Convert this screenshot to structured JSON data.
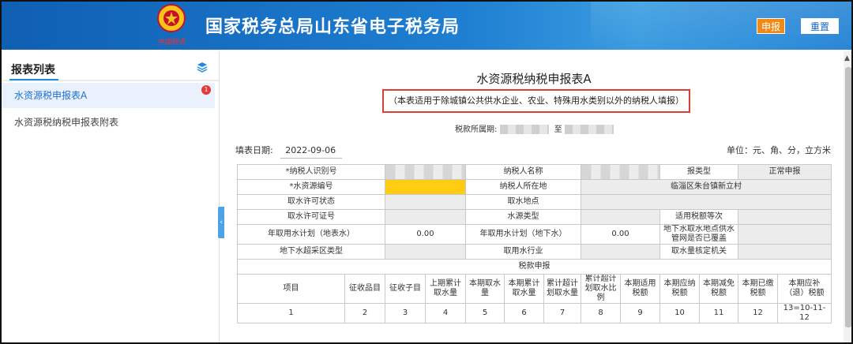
{
  "header": {
    "title": "国家税务总局山东省电子税务局",
    "emblem_caption": "中国税务",
    "submit_label": "申报",
    "reset_label": "重置"
  },
  "sidebar": {
    "title": "报表列表",
    "items": [
      {
        "label": "水资源税申报表A",
        "badge": "1",
        "active": true
      },
      {
        "label": "水资源税纳税申报表附表",
        "active": false
      }
    ]
  },
  "form": {
    "title": "水资源税纳税申报表A",
    "note": "（本表适用于除城镇公共供水企业、农业、特殊用水类别以外的纳税人填报）",
    "period_label": "税款所属期:",
    "period_to": "至",
    "fill_date_label": "填表日期:",
    "fill_date": "2022-09-06",
    "units": "单位：元、角、分，立方米"
  },
  "table": {
    "rows": [
      [
        "*纳税人识别号",
        "",
        "纳税人名称",
        "",
        "报类型",
        "正常申报"
      ],
      [
        "*水资源编号",
        "",
        "纳税人所在地",
        "临淄区朱台镇新立村"
      ],
      [
        "取水许可状态",
        "",
        "取水地点",
        ""
      ],
      [
        "取水许可证号",
        "",
        "水源类型",
        "",
        "适用税额等次",
        ""
      ],
      [
        "年取用水计划（地表水）",
        "0.00",
        "年取用水计划（地下水）",
        "0.00",
        "地下水取水地点供水管网是否已覆盖",
        ""
      ],
      [
        "地下水超采区类型",
        "",
        "取用水行业",
        "",
        "取水量核定机关",
        ""
      ]
    ],
    "section_title": "税款申报",
    "columns": [
      "项目",
      "征收品目",
      "征收子目",
      "上期累计取水量",
      "本期取水量",
      "本期累计取水量",
      "累计超计划取水量",
      "累计超计划取水比例",
      "本期适用税额",
      "本期应纳税额",
      "本期减免税额",
      "本期已缴税额",
      "本期应补（退）税额"
    ],
    "column_numbers": [
      "1",
      "2",
      "3",
      "4",
      "5",
      "6",
      "7",
      "8",
      "9",
      "10",
      "11",
      "12",
      "13=10-11-12"
    ]
  },
  "colors": {
    "header_blue": "#1f7fd2",
    "accent_orange": "#f08a14",
    "highlight_yellow": "#ffcc11",
    "note_border_red": "#e53935"
  }
}
